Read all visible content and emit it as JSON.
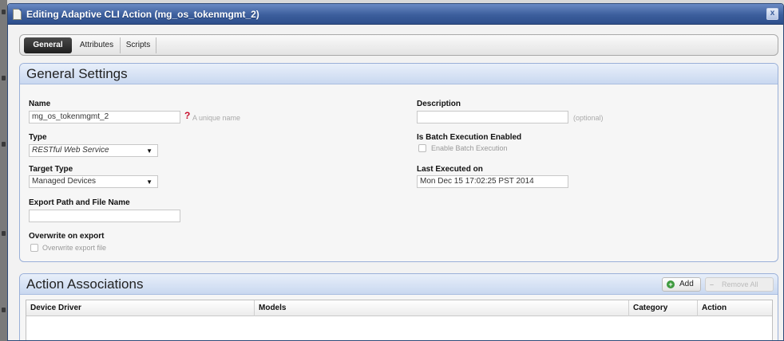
{
  "window": {
    "title": "Editing Adaptive CLI Action (mg_os_tokenmgmt_2)",
    "close_glyph": "x",
    "accent_color": "#3c5e9c"
  },
  "tabs": [
    {
      "label": "General",
      "active": true
    },
    {
      "label": "Attributes",
      "active": false
    },
    {
      "label": "Scripts",
      "active": false
    }
  ],
  "general_settings": {
    "title": "General Settings",
    "name": {
      "label": "Name",
      "value": "mg_os_tokenmgmt_2",
      "required_marker": "?",
      "hint": "A unique name"
    },
    "type": {
      "label": "Type",
      "value": "RESTful Web Service"
    },
    "target_type": {
      "label": "Target Type",
      "value": "Managed Devices"
    },
    "export_path": {
      "label": "Export Path and File Name",
      "value": ""
    },
    "overwrite": {
      "label": "Overwrite on export",
      "checkbox_label": "Overwrite export file",
      "checked": false
    },
    "description": {
      "label": "Description",
      "value": "",
      "hint": "(optional)"
    },
    "batch": {
      "label": "Is Batch Execution Enabled",
      "checkbox_label": "Enable Batch Execution",
      "checked": false
    },
    "last_executed": {
      "label": "Last Executed on",
      "value": "Mon Dec 15 17:02:25 PST 2014"
    }
  },
  "action_associations": {
    "title": "Action Associations",
    "add_label": "Add",
    "remove_label": "Remove All",
    "columns": [
      "Device Driver",
      "Models",
      "Category",
      "Action"
    ],
    "rows": []
  },
  "icons": {
    "title": "document-icon",
    "close": "close-icon",
    "required": "required-icon",
    "add": "plus-icon",
    "remove": "minus-icon",
    "dropdown": "chevron-down-icon"
  }
}
